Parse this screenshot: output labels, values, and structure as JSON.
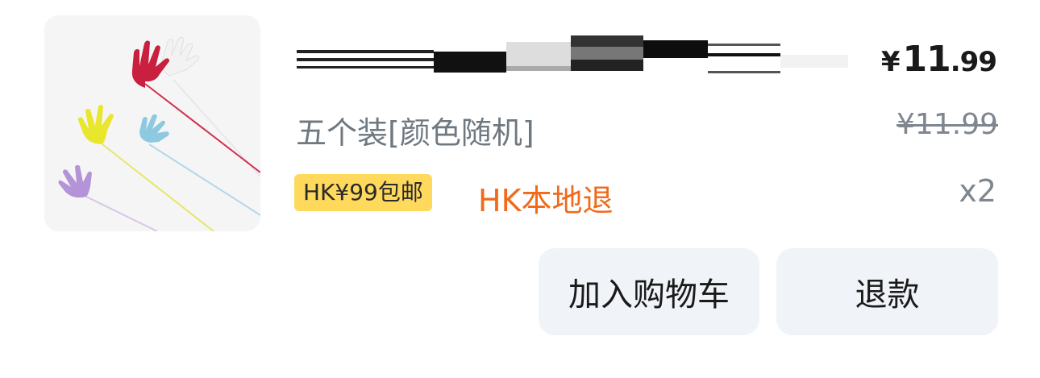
{
  "product": {
    "title": "",
    "variant": "五个装[颜色随机]",
    "price": {
      "currency": "¥",
      "integer": "11",
      "decimal": ".99"
    },
    "original_price": "¥11.99",
    "quantity": "x2",
    "shipping_badge": "HK¥99包邮",
    "return_policy": "HK本地退",
    "image_icon": "sticky-hand-toy-icon"
  },
  "actions": {
    "add_to_cart_label": "加入购物车",
    "refund_label": "退款"
  },
  "colors": {
    "badge_bg": "#ffd95c",
    "return_policy": "#f06a1a",
    "muted_text": "#7e8790",
    "button_bg": "#f0f3f7"
  }
}
